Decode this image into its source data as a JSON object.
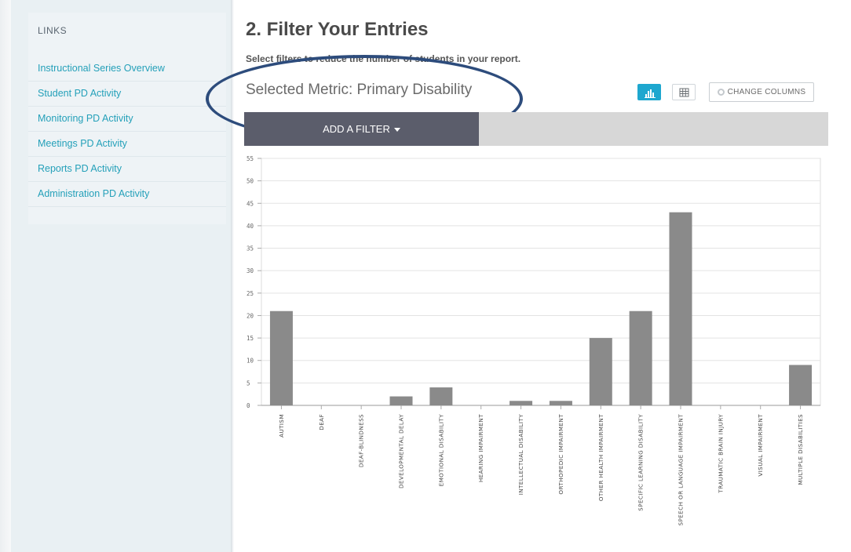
{
  "sidebar": {
    "title": "LINKS",
    "items": [
      {
        "label": "Instructional Series Overview"
      },
      {
        "label": "Student PD Activity"
      },
      {
        "label": "Monitoring PD Activity"
      },
      {
        "label": "Meetings PD Activity"
      },
      {
        "label": "Reports PD Activity"
      },
      {
        "label": "Administration PD Activity"
      }
    ]
  },
  "main": {
    "title": "2. Filter Your Entries",
    "subtitle": "Select filters to reduce the number of students in your report.",
    "metric": "Selected Metric: Primary Disability",
    "add_filter_label": "ADD A FILTER",
    "change_columns_label": "CHANGE COLUMNS",
    "view_toggle": {
      "active": "chart",
      "options": [
        "chart-icon",
        "table-icon"
      ]
    }
  },
  "colors": {
    "accent": "#1ea7cf",
    "link": "#24a0b9",
    "bar": "#8a8a8a",
    "filter_button": "#5b5d6b",
    "annotation": "#2d4c7c"
  },
  "chart_data": {
    "type": "bar",
    "categories": [
      "AUTISM",
      "DEAF",
      "DEAF-BLINDNESS",
      "DEVELOPMENTAL DELAY",
      "EMOTIONAL DISABILITY",
      "HEARING IMPAIRMENT",
      "INTELLECTUAL DISABILITY",
      "ORTHOPEDIC IMPAIRMENT",
      "OTHER HEALTH IMPAIRMENT",
      "SPECIFIC LEARNING DISABILITY",
      "SPEECH OR LANGUAGE IMPAIRMENT",
      "TRAUMATIC BRAIN INJURY",
      "VISUAL IMPAIRMENT",
      "MULTIPLE DISABILITIES"
    ],
    "values": [
      21,
      0,
      0,
      2,
      4,
      0,
      1,
      1,
      15,
      21,
      43,
      0,
      0,
      9
    ],
    "yticks": [
      0,
      5,
      10,
      15,
      20,
      25,
      30,
      35,
      40,
      45,
      50,
      55
    ],
    "ylim": [
      0,
      55
    ],
    "grid": true,
    "legend": "none"
  }
}
